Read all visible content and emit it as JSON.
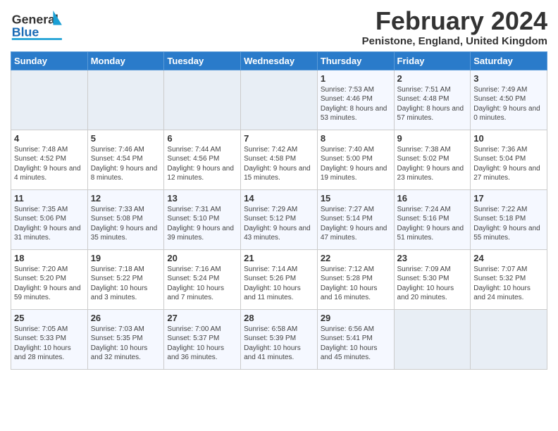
{
  "header": {
    "logo_general": "General",
    "logo_blue": "Blue",
    "month_year": "February 2024",
    "location": "Penistone, England, United Kingdom"
  },
  "weekdays": [
    "Sunday",
    "Monday",
    "Tuesday",
    "Wednesday",
    "Thursday",
    "Friday",
    "Saturday"
  ],
  "weeks": [
    [
      {
        "day": "",
        "sunrise": "",
        "sunset": "",
        "daylight": ""
      },
      {
        "day": "",
        "sunrise": "",
        "sunset": "",
        "daylight": ""
      },
      {
        "day": "",
        "sunrise": "",
        "sunset": "",
        "daylight": ""
      },
      {
        "day": "",
        "sunrise": "",
        "sunset": "",
        "daylight": ""
      },
      {
        "day": "1",
        "sunrise": "Sunrise: 7:53 AM",
        "sunset": "Sunset: 4:46 PM",
        "daylight": "Daylight: 8 hours and 53 minutes."
      },
      {
        "day": "2",
        "sunrise": "Sunrise: 7:51 AM",
        "sunset": "Sunset: 4:48 PM",
        "daylight": "Daylight: 8 hours and 57 minutes."
      },
      {
        "day": "3",
        "sunrise": "Sunrise: 7:49 AM",
        "sunset": "Sunset: 4:50 PM",
        "daylight": "Daylight: 9 hours and 0 minutes."
      }
    ],
    [
      {
        "day": "4",
        "sunrise": "Sunrise: 7:48 AM",
        "sunset": "Sunset: 4:52 PM",
        "daylight": "Daylight: 9 hours and 4 minutes."
      },
      {
        "day": "5",
        "sunrise": "Sunrise: 7:46 AM",
        "sunset": "Sunset: 4:54 PM",
        "daylight": "Daylight: 9 hours and 8 minutes."
      },
      {
        "day": "6",
        "sunrise": "Sunrise: 7:44 AM",
        "sunset": "Sunset: 4:56 PM",
        "daylight": "Daylight: 9 hours and 12 minutes."
      },
      {
        "day": "7",
        "sunrise": "Sunrise: 7:42 AM",
        "sunset": "Sunset: 4:58 PM",
        "daylight": "Daylight: 9 hours and 15 minutes."
      },
      {
        "day": "8",
        "sunrise": "Sunrise: 7:40 AM",
        "sunset": "Sunset: 5:00 PM",
        "daylight": "Daylight: 9 hours and 19 minutes."
      },
      {
        "day": "9",
        "sunrise": "Sunrise: 7:38 AM",
        "sunset": "Sunset: 5:02 PM",
        "daylight": "Daylight: 9 hours and 23 minutes."
      },
      {
        "day": "10",
        "sunrise": "Sunrise: 7:36 AM",
        "sunset": "Sunset: 5:04 PM",
        "daylight": "Daylight: 9 hours and 27 minutes."
      }
    ],
    [
      {
        "day": "11",
        "sunrise": "Sunrise: 7:35 AM",
        "sunset": "Sunset: 5:06 PM",
        "daylight": "Daylight: 9 hours and 31 minutes."
      },
      {
        "day": "12",
        "sunrise": "Sunrise: 7:33 AM",
        "sunset": "Sunset: 5:08 PM",
        "daylight": "Daylight: 9 hours and 35 minutes."
      },
      {
        "day": "13",
        "sunrise": "Sunrise: 7:31 AM",
        "sunset": "Sunset: 5:10 PM",
        "daylight": "Daylight: 9 hours and 39 minutes."
      },
      {
        "day": "14",
        "sunrise": "Sunrise: 7:29 AM",
        "sunset": "Sunset: 5:12 PM",
        "daylight": "Daylight: 9 hours and 43 minutes."
      },
      {
        "day": "15",
        "sunrise": "Sunrise: 7:27 AM",
        "sunset": "Sunset: 5:14 PM",
        "daylight": "Daylight: 9 hours and 47 minutes."
      },
      {
        "day": "16",
        "sunrise": "Sunrise: 7:24 AM",
        "sunset": "Sunset: 5:16 PM",
        "daylight": "Daylight: 9 hours and 51 minutes."
      },
      {
        "day": "17",
        "sunrise": "Sunrise: 7:22 AM",
        "sunset": "Sunset: 5:18 PM",
        "daylight": "Daylight: 9 hours and 55 minutes."
      }
    ],
    [
      {
        "day": "18",
        "sunrise": "Sunrise: 7:20 AM",
        "sunset": "Sunset: 5:20 PM",
        "daylight": "Daylight: 9 hours and 59 minutes."
      },
      {
        "day": "19",
        "sunrise": "Sunrise: 7:18 AM",
        "sunset": "Sunset: 5:22 PM",
        "daylight": "Daylight: 10 hours and 3 minutes."
      },
      {
        "day": "20",
        "sunrise": "Sunrise: 7:16 AM",
        "sunset": "Sunset: 5:24 PM",
        "daylight": "Daylight: 10 hours and 7 minutes."
      },
      {
        "day": "21",
        "sunrise": "Sunrise: 7:14 AM",
        "sunset": "Sunset: 5:26 PM",
        "daylight": "Daylight: 10 hours and 11 minutes."
      },
      {
        "day": "22",
        "sunrise": "Sunrise: 7:12 AM",
        "sunset": "Sunset: 5:28 PM",
        "daylight": "Daylight: 10 hours and 16 minutes."
      },
      {
        "day": "23",
        "sunrise": "Sunrise: 7:09 AM",
        "sunset": "Sunset: 5:30 PM",
        "daylight": "Daylight: 10 hours and 20 minutes."
      },
      {
        "day": "24",
        "sunrise": "Sunrise: 7:07 AM",
        "sunset": "Sunset: 5:32 PM",
        "daylight": "Daylight: 10 hours and 24 minutes."
      }
    ],
    [
      {
        "day": "25",
        "sunrise": "Sunrise: 7:05 AM",
        "sunset": "Sunset: 5:33 PM",
        "daylight": "Daylight: 10 hours and 28 minutes."
      },
      {
        "day": "26",
        "sunrise": "Sunrise: 7:03 AM",
        "sunset": "Sunset: 5:35 PM",
        "daylight": "Daylight: 10 hours and 32 minutes."
      },
      {
        "day": "27",
        "sunrise": "Sunrise: 7:00 AM",
        "sunset": "Sunset: 5:37 PM",
        "daylight": "Daylight: 10 hours and 36 minutes."
      },
      {
        "day": "28",
        "sunrise": "Sunrise: 6:58 AM",
        "sunset": "Sunset: 5:39 PM",
        "daylight": "Daylight: 10 hours and 41 minutes."
      },
      {
        "day": "29",
        "sunrise": "Sunrise: 6:56 AM",
        "sunset": "Sunset: 5:41 PM",
        "daylight": "Daylight: 10 hours and 45 minutes."
      },
      {
        "day": "",
        "sunrise": "",
        "sunset": "",
        "daylight": ""
      },
      {
        "day": "",
        "sunrise": "",
        "sunset": "",
        "daylight": ""
      }
    ]
  ]
}
